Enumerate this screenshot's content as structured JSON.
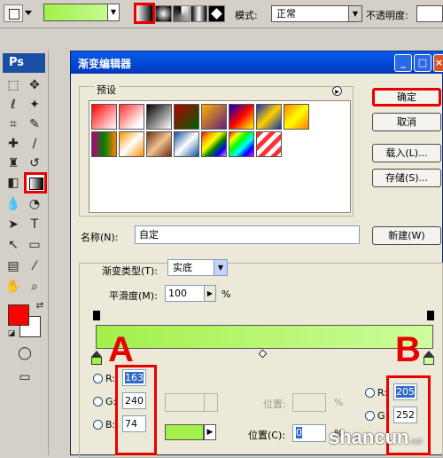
{
  "options_bar": {
    "mode_label": "模式:",
    "mode_value": "正常",
    "opacity_label": "不透明度:",
    "gradient_colors": [
      "#a3f04a",
      "#cdfc9c"
    ]
  },
  "toolbox": {
    "logo": "Ps",
    "foreground_color": "#ff0000",
    "background_color": "#ffffff"
  },
  "dialog": {
    "title": "渐变编辑器",
    "presets_label": "预设",
    "buttons": {
      "ok": "确定",
      "cancel": "取消",
      "load": "载入(L)...",
      "save": "存储(S)...",
      "new": "新建(W)"
    },
    "name_label": "名称(N):",
    "name_value": "自定",
    "gradient_type_label": "渐变类型(T):",
    "gradient_type_value": "实底",
    "smoothness_label": "平滑度(M):",
    "smoothness_value": "100",
    "percent": "%",
    "annotations": {
      "a": "A",
      "b": "B"
    },
    "left_stop": {
      "r_label": "R:",
      "g_label": "G:",
      "b_label": "B:",
      "r": "163",
      "g": "240",
      "b": "74"
    },
    "right_stop": {
      "r_label": "R:",
      "g_label": "G:",
      "r": "205",
      "g": "252"
    },
    "position_label_dim": "位置:",
    "position_label": "位置(C):",
    "position_value": "0",
    "watermark": "shancun",
    "watermark_suffix": ".net"
  }
}
